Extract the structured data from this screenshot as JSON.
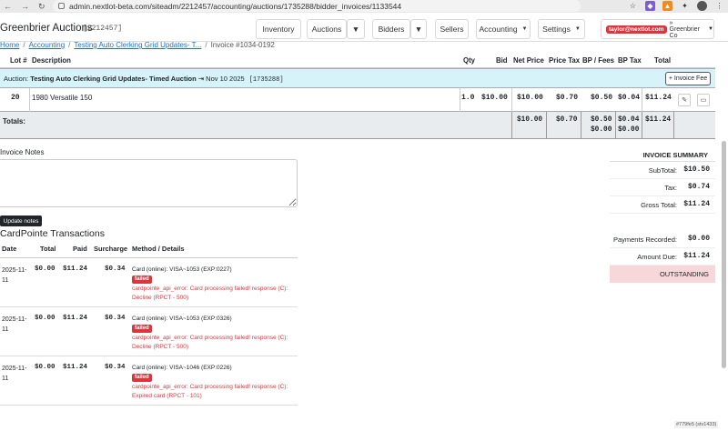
{
  "browser": {
    "url": "admin.nextlot-beta.com/siteadm/2212457/accounting/auctions/1735288/bidder_invoices/1133544"
  },
  "header": {
    "brand": "Greenbrier Auctions",
    "site_id": "[2212457]",
    "nav": [
      "Inventory",
      "Auctions",
      "Bidders",
      "Sellers",
      "Accounting",
      "Settings"
    ],
    "user_email": "taylor@nextlot.com",
    "org": "Greenbrier Co"
  },
  "breadcrumb": {
    "home": "Home",
    "accounting": "Accounting",
    "auction": "Testing Auto Clerking Grid Updates- T...",
    "current": "Invoice #1034-0192"
  },
  "table": {
    "headers": {
      "lot": "Lot #",
      "desc": "Description",
      "qty": "Qty",
      "bid": "Bid",
      "net": "Net Price",
      "ptax": "Price Tax",
      "bpfees": "BP / Fees",
      "bptax": "BP Tax",
      "total": "Total"
    },
    "auction_label": "Auction:",
    "auction_name": "Testing Auto Clerking Grid Updates- Timed Auction",
    "auction_date": "⇥ Nov 10 2025",
    "auction_id": "[1735288]",
    "invoice_fee": "+ Invoice Fee",
    "row": {
      "lot": "20",
      "desc": "1980 Versatile 150",
      "qty": "1.0",
      "bid": "$10.00",
      "net": "$10.00",
      "ptax": "$0.70",
      "bpfees": "$0.50",
      "bptax": "$0.04",
      "total": "$11.24"
    },
    "totals": {
      "label": "Totals:",
      "net": "$10.00",
      "ptax": "$0.70",
      "bpfees": "$0.50",
      "bpfees2": "$0.00",
      "bptax": "$0.04",
      "bptax2": "$0.00",
      "total": "$11.24"
    }
  },
  "notes": {
    "label": "Invoice Notes",
    "button": "Update notes"
  },
  "cardpointe": {
    "title": "CardPointe Transactions",
    "headers": {
      "date": "Date",
      "total": "Total",
      "paid": "Paid",
      "surcharge": "Surcharge",
      "method": "Method / Details"
    },
    "rows": [
      {
        "date": "2025-11-11",
        "total": "$0.00",
        "paid": "$11.24",
        "surcharge": "$0.34",
        "method": "Card (online): VISA~1053 (EXP:0227)",
        "status": "failed",
        "error": "cardpointe_api_error: Card processing failed! response (C): Decline (RPCT - 500)"
      },
      {
        "date": "2025-11-11",
        "total": "$0.00",
        "paid": "$11.24",
        "surcharge": "$0.34",
        "method": "Card (online): VISA~1053 (EXP:0326)",
        "status": "failed",
        "error": "cardpointe_api_error: Card processing failed! response (C): Decline (RPCT - 500)"
      },
      {
        "date": "2025-11-11",
        "total": "$0.00",
        "paid": "$11.24",
        "surcharge": "$0.34",
        "method": "Card (online): VISA~1046 (EXP:0226)",
        "status": "failed",
        "error": "cardpointe_api_error: Card processing failed! response (C): Expired card (RPCT - 101)"
      }
    ]
  },
  "summary": {
    "title": "INVOICE SUMMARY",
    "subtotal_l": "SubTotal:",
    "subtotal": "$10.50",
    "tax_l": "Tax:",
    "tax": "$0.74",
    "gross_l": "Gross Total:",
    "gross": "$11.24",
    "pay_l": "Payments Recorded:",
    "pay": "$0.00",
    "due_l": "Amount Due:",
    "due": "$11.24",
    "status": "OUTSTANDING"
  },
  "version": "#779fe5 (stv1433)"
}
